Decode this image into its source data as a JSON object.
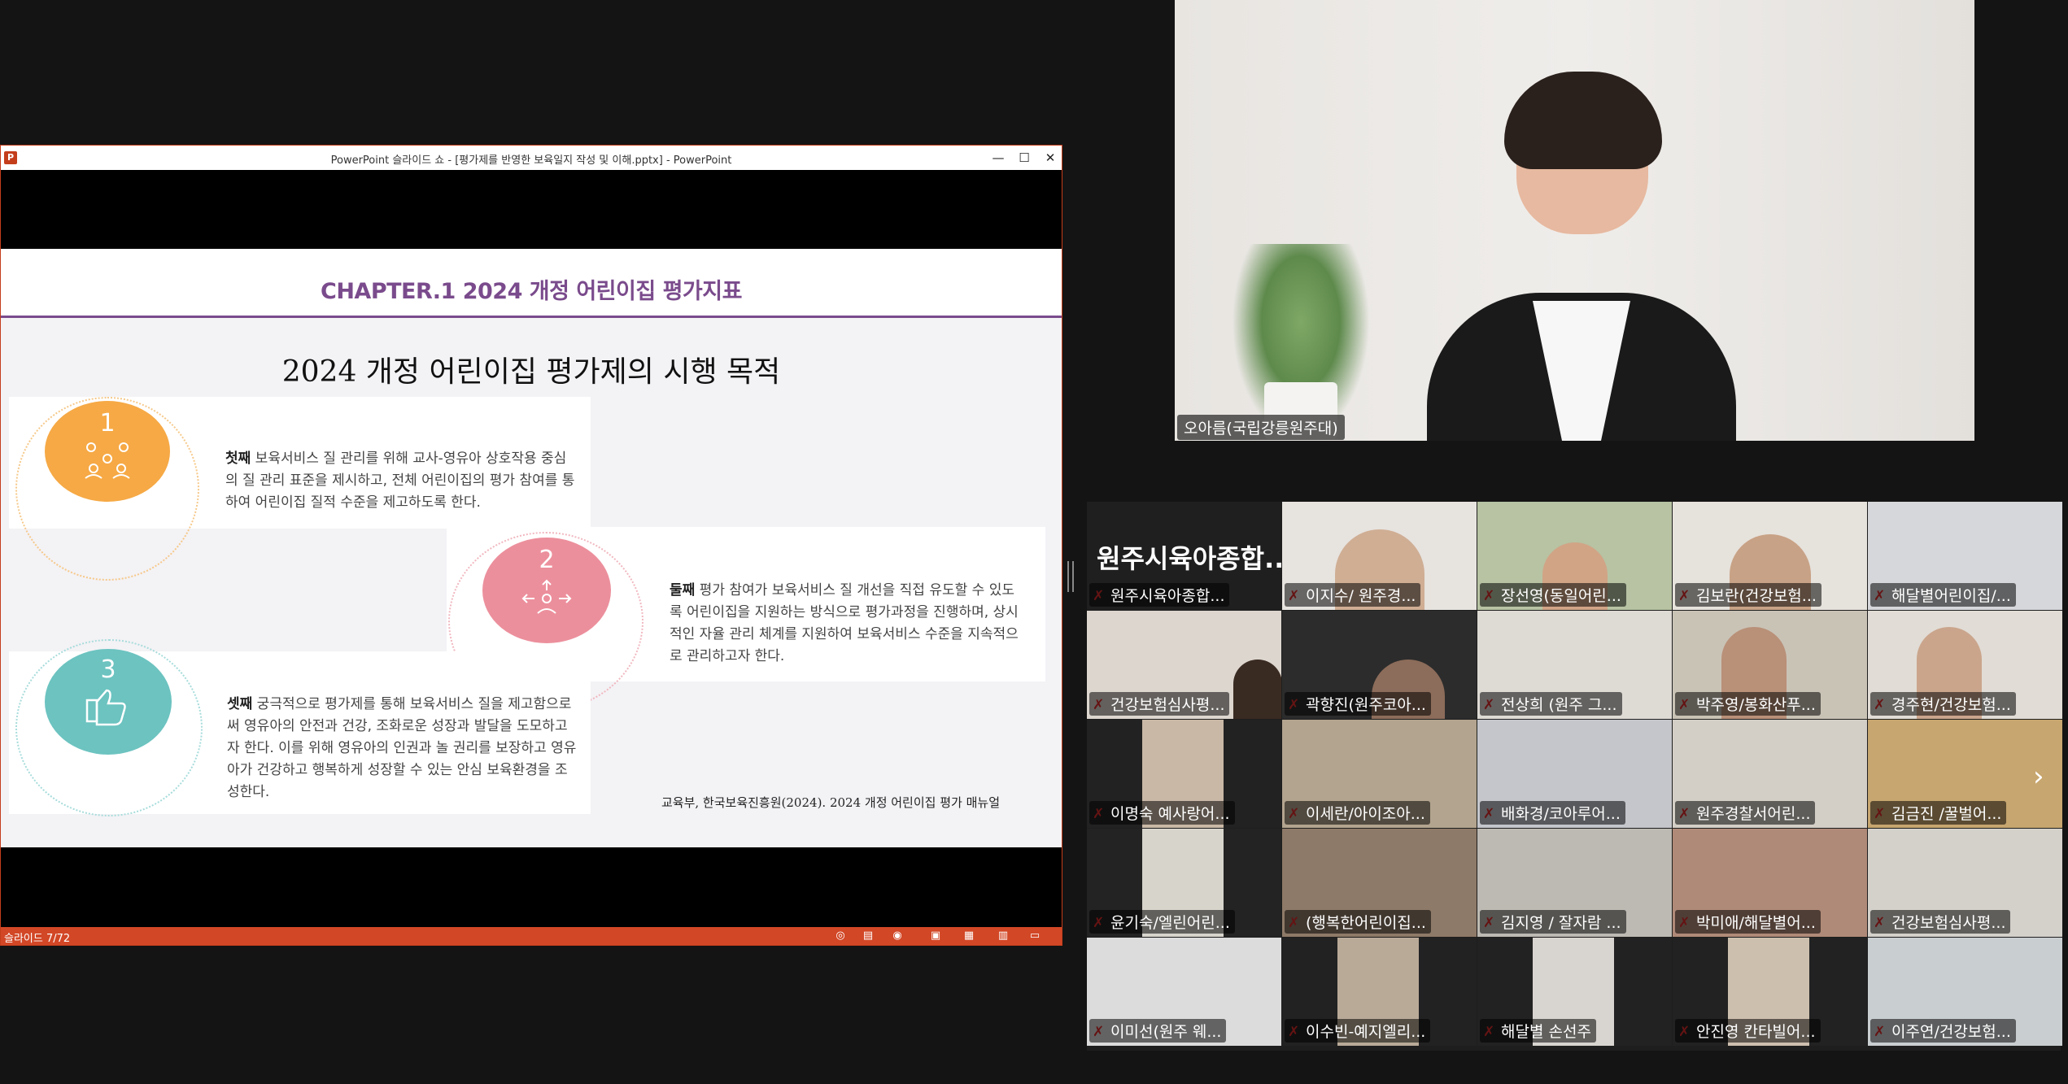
{
  "powerpoint": {
    "window_title": "PowerPoint 슬라이드 쇼 - [평가제를 반영한 보육일지 작성 및 이해.pptx] - PowerPoint",
    "logo_letter": "P",
    "buttons": {
      "minimize": "—",
      "maximize": "☐",
      "close": "✕"
    },
    "status": "슬라이드 7/72"
  },
  "slide": {
    "chapter": "CHAPTER.1 2024 개정 어린이집 평가지표",
    "title": "2024 개정 어린이집 평가제의 시행 목적",
    "items": [
      {
        "number": "1",
        "lead": "첫째",
        "text": " 보육서비스 질 관리를 위해 교사-영유아 상호작용 중심의 질 관리 표준을 제시하고, 전체 어린이집의 평가 참여를 통하여 어린이집 질적 수준을 제고하도록 한다.",
        "color": "#f6a945"
      },
      {
        "number": "2",
        "lead": "둘째",
        "text": " 평가 참여가 보육서비스 질 개선을 직접 유도할 수 있도록 어린이집을 지원하는 방식으로 평가과정을 진행하며, 상시적인 자율 관리 체계를 지원하여 보육서비스 수준을 지속적으로 관리하고자 한다.",
        "color": "#ec8f9c"
      },
      {
        "number": "3",
        "lead": "셋째",
        "text": " 궁극적으로 평가제를 통해 보육서비스 질을 제고함으로써 영유아의 안전과 건강, 조화로운 성장과 발달을 도모하고자 한다. 이를 위해 영유아의 인권과 놀 권리를 보장하고 영유아가 건강하고 행복하게 성장할 수 있는 안심 보육환경을 조성한다.",
        "color": "#6cc3c0"
      }
    ],
    "citation": "교육부, 한국보육진흥원(2024). 2024 개정 어린이집 평가 매뉴얼"
  },
  "speaker": {
    "name": "오아름(국립강릉원주대)"
  },
  "gallery": {
    "first_tile_big": "원주시육아종합...",
    "next_icon": "chevron-right-icon",
    "participants": [
      "원주시육아종합...",
      "이지수/ 원주경...",
      "장선영(동일어린...",
      "김보란(건강보험...",
      "해달별어린이집/...",
      "건강보험심사평...",
      "곽향진(원주코아...",
      "전상희 (원주 그...",
      "박주영/봉화산푸...",
      "경주현/건강보험...",
      "이명숙 예사랑어...",
      "이세란/아이조아...",
      "배화경/코아루어...",
      "원주경찰서어린...",
      "김금진 /꿀벌어...",
      "윤기숙/엘린어린...",
      "(행복한어린이집...",
      "김지영 / 잘자람 ...",
      "박미애/해달별어...",
      "건강보험심사평...",
      "이미선(원주 웨...",
      "이수빈-예지엘리...",
      "해달별 손선주",
      "안진영 칸타빌어...",
      "이주연/건강보험..."
    ]
  },
  "colors": {
    "ppt_accent": "#d24726",
    "chapter_purple": "#7a4b8c",
    "muted_red": "#e02c2c"
  }
}
